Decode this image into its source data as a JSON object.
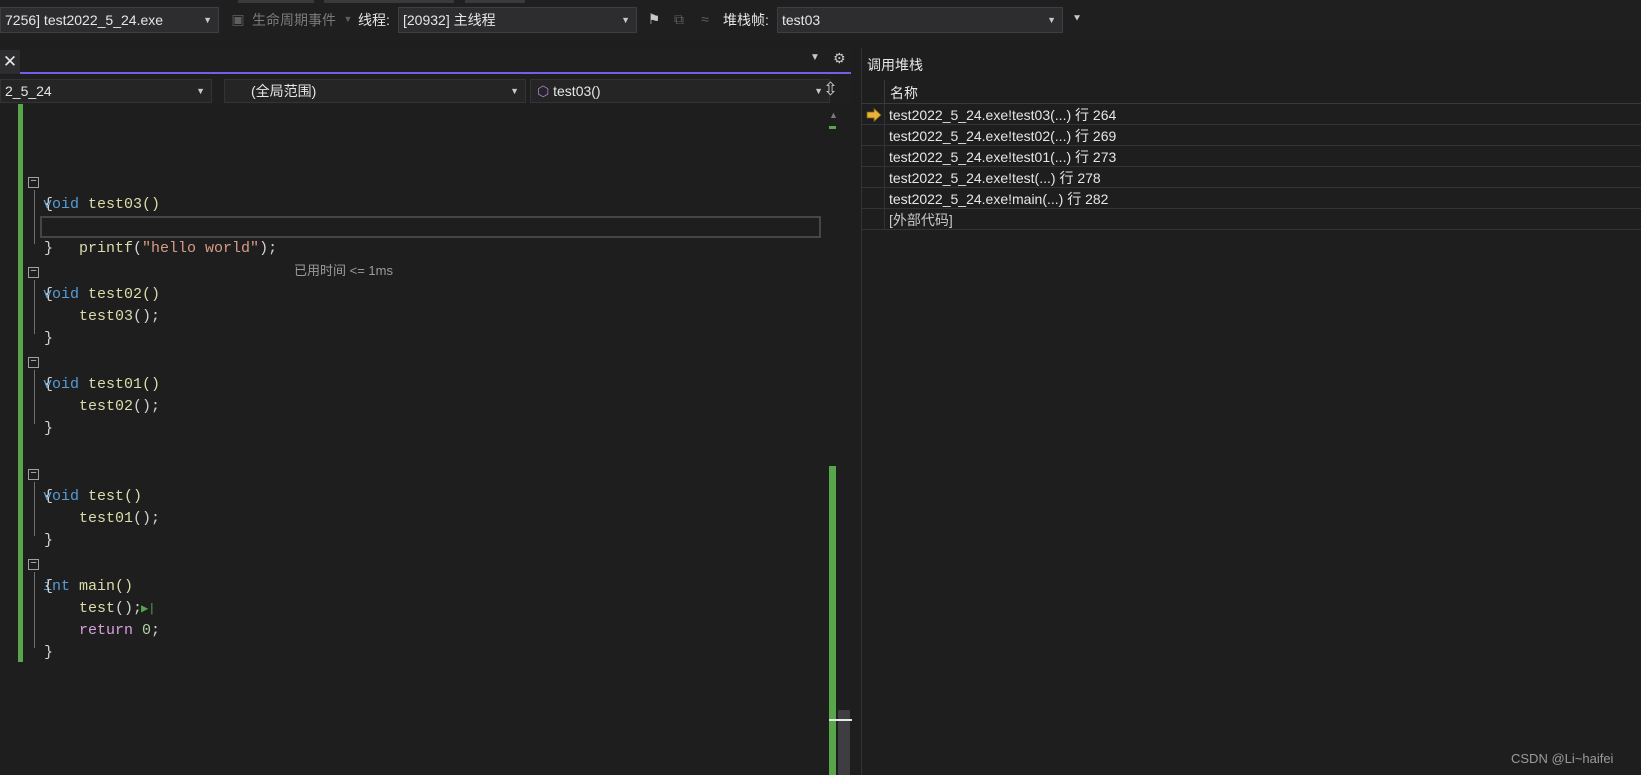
{
  "toolbar": {
    "process": "7256] test2022_5_24.exe",
    "lifecycle_events": "生命周期事件",
    "thread_label": "线程:",
    "thread_value": "[20932] 主线程",
    "stack_frame_label": "堆栈帧:",
    "stack_frame_value": "test03"
  },
  "editor": {
    "nav": {
      "project": "2_5_24",
      "scope": "(全局范围)",
      "member": "test03()"
    },
    "code_lines": [
      {
        "prefix": "",
        "kw": "void",
        "rest": " test03()"
      },
      {
        "text": "{"
      },
      {
        "call": "printf",
        "open": "(",
        "string": "\"hello world\"",
        "close": ");",
        "hint": "已用时间 <= 1ms"
      },
      {
        "text": "}"
      },
      {
        "kw": "void",
        "rest": " test02()"
      },
      {
        "text": "{"
      },
      {
        "call": "test03",
        "rest": "();"
      },
      {
        "text": "}"
      },
      {
        "kw": "void",
        "rest": " test01()"
      },
      {
        "text": "{"
      },
      {
        "call": "test02",
        "rest": "();"
      },
      {
        "text": "}"
      },
      {
        "kw": "void",
        "rest": " test()"
      },
      {
        "text": "{"
      },
      {
        "call": "test01",
        "rest": "();"
      },
      {
        "text": "}"
      },
      {
        "kw": "int",
        "rest": " main()"
      },
      {
        "text": "{"
      },
      {
        "call": "test",
        "rest": "();"
      },
      {
        "ret": "return",
        "num": "0",
        "rest": ";"
      },
      {
        "text": "}"
      }
    ]
  },
  "call_stack": {
    "title": "调用堆栈",
    "column_name": "名称",
    "rows": [
      "test2022_5_24.exe!test03(...) 行 264",
      "test2022_5_24.exe!test02(...) 行 269",
      "test2022_5_24.exe!test01(...) 行 273",
      "test2022_5_24.exe!test(...) 行 278",
      "test2022_5_24.exe!main(...) 行 282",
      "[外部代码]"
    ]
  },
  "watermark": "CSDN @Li~haifei",
  "colors": {
    "accent": "#7160e8",
    "change_bar": "#57a64a",
    "keyword": "#569cd6",
    "function": "#dcdcaa",
    "string": "#d69d85",
    "current_frame_arrow": "#e8b339"
  }
}
